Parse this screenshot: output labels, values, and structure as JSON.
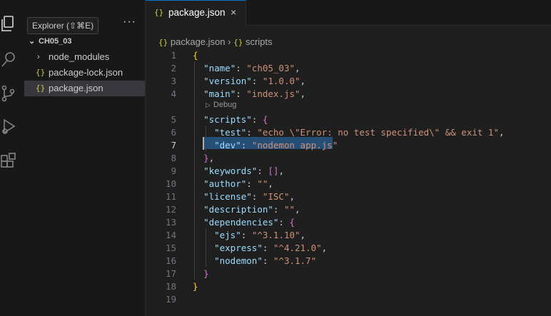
{
  "activity_bar": {
    "icons": [
      "explorer-icon",
      "search-icon",
      "source-control-icon",
      "run-debug-icon",
      "extensions-icon"
    ]
  },
  "sidebar": {
    "tooltip": "Explorer (⇧⌘E)",
    "more_label": "···",
    "folder_name": "CH05_03",
    "items": [
      {
        "label": "node_modules",
        "type": "folder"
      },
      {
        "label": "package-lock.json",
        "type": "json"
      },
      {
        "label": "package.json",
        "type": "json",
        "selected": true
      }
    ]
  },
  "editor": {
    "tab": {
      "label": "package.json",
      "icon": "{}",
      "close": "×"
    },
    "breadcrumb": {
      "file": "package.json",
      "separator": "›",
      "symbol": "scripts",
      "icon": "{}"
    },
    "codelens": {
      "label": "Debug",
      "icon": "▷"
    },
    "current_line": 7,
    "line_numbers": [
      "1",
      "2",
      "3",
      "4",
      "5",
      "6",
      "7",
      "8",
      "9",
      "10",
      "11",
      "12",
      "13",
      "14",
      "15",
      "16",
      "17",
      "18",
      "19"
    ],
    "lines": [
      {
        "tokens": [
          {
            "t": "{",
            "c": "b1"
          }
        ]
      },
      {
        "tokens": [
          {
            "t": "  ",
            "c": "p"
          },
          {
            "t": "\"name\"",
            "c": "k"
          },
          {
            "t": ": ",
            "c": "p"
          },
          {
            "t": "\"ch05_03\"",
            "c": "s"
          },
          {
            "t": ",",
            "c": "p"
          }
        ]
      },
      {
        "tokens": [
          {
            "t": "  ",
            "c": "p"
          },
          {
            "t": "\"version\"",
            "c": "k"
          },
          {
            "t": ": ",
            "c": "p"
          },
          {
            "t": "\"1.0.0\"",
            "c": "s"
          },
          {
            "t": ",",
            "c": "p"
          }
        ]
      },
      {
        "tokens": [
          {
            "t": "  ",
            "c": "p"
          },
          {
            "t": "\"main\"",
            "c": "k"
          },
          {
            "t": ": ",
            "c": "p"
          },
          {
            "t": "\"index.js\"",
            "c": "s"
          },
          {
            "t": ",",
            "c": "p"
          }
        ]
      },
      {
        "tokens": [
          {
            "t": "  ",
            "c": "p"
          },
          {
            "t": "\"scripts\"",
            "c": "k"
          },
          {
            "t": ": ",
            "c": "p"
          },
          {
            "t": "{",
            "c": "b2"
          }
        ]
      },
      {
        "tokens": [
          {
            "t": "    ",
            "c": "p"
          },
          {
            "t": "\"test\"",
            "c": "k"
          },
          {
            "t": ": ",
            "c": "p"
          },
          {
            "t": "\"echo \\\"Error: no test specified\\\" && exit 1\"",
            "c": "s"
          },
          {
            "t": ",",
            "c": "p"
          }
        ]
      },
      {
        "tokens": [
          {
            "t": "    ",
            "c": "p"
          },
          {
            "t": "\"dev\"",
            "c": "k"
          },
          {
            "t": ": ",
            "c": "p"
          },
          {
            "t": "\"nodemon app.js\"",
            "c": "s"
          }
        ]
      },
      {
        "tokens": [
          {
            "t": "  ",
            "c": "p"
          },
          {
            "t": "}",
            "c": "b2"
          },
          {
            "t": ",",
            "c": "p"
          }
        ]
      },
      {
        "tokens": [
          {
            "t": "  ",
            "c": "p"
          },
          {
            "t": "\"keywords\"",
            "c": "k"
          },
          {
            "t": ": ",
            "c": "p"
          },
          {
            "t": "[]",
            "c": "b2"
          },
          {
            "t": ",",
            "c": "p"
          }
        ]
      },
      {
        "tokens": [
          {
            "t": "  ",
            "c": "p"
          },
          {
            "t": "\"author\"",
            "c": "k"
          },
          {
            "t": ": ",
            "c": "p"
          },
          {
            "t": "\"\"",
            "c": "s"
          },
          {
            "t": ",",
            "c": "p"
          }
        ]
      },
      {
        "tokens": [
          {
            "t": "  ",
            "c": "p"
          },
          {
            "t": "\"license\"",
            "c": "k"
          },
          {
            "t": ": ",
            "c": "p"
          },
          {
            "t": "\"ISC\"",
            "c": "s"
          },
          {
            "t": ",",
            "c": "p"
          }
        ]
      },
      {
        "tokens": [
          {
            "t": "  ",
            "c": "p"
          },
          {
            "t": "\"description\"",
            "c": "k"
          },
          {
            "t": ": ",
            "c": "p"
          },
          {
            "t": "\"\"",
            "c": "s"
          },
          {
            "t": ",",
            "c": "p"
          }
        ]
      },
      {
        "tokens": [
          {
            "t": "  ",
            "c": "p"
          },
          {
            "t": "\"dependencies\"",
            "c": "k"
          },
          {
            "t": ": ",
            "c": "p"
          },
          {
            "t": "{",
            "c": "b2"
          }
        ]
      },
      {
        "tokens": [
          {
            "t": "    ",
            "c": "p"
          },
          {
            "t": "\"ejs\"",
            "c": "k"
          },
          {
            "t": ": ",
            "c": "p"
          },
          {
            "t": "\"^3.1.10\"",
            "c": "s"
          },
          {
            "t": ",",
            "c": "p"
          }
        ]
      },
      {
        "tokens": [
          {
            "t": "    ",
            "c": "p"
          },
          {
            "t": "\"express\"",
            "c": "k"
          },
          {
            "t": ": ",
            "c": "p"
          },
          {
            "t": "\"^4.21.0\"",
            "c": "s"
          },
          {
            "t": ",",
            "c": "p"
          }
        ]
      },
      {
        "tokens": [
          {
            "t": "    ",
            "c": "p"
          },
          {
            "t": "\"nodemon\"",
            "c": "k"
          },
          {
            "t": ": ",
            "c": "p"
          },
          {
            "t": "\"^3.1.7\"",
            "c": "s"
          }
        ]
      },
      {
        "tokens": [
          {
            "t": "  ",
            "c": "p"
          },
          {
            "t": "}",
            "c": "b2"
          }
        ]
      },
      {
        "tokens": [
          {
            "t": "}",
            "c": "b1"
          }
        ]
      },
      {
        "tokens": []
      }
    ]
  },
  "colors": {
    "accent": "#0078d4",
    "key": "#9cdcfe",
    "string": "#ce9178",
    "bracket_outer": "#ffd700",
    "bracket_inner": "#da70d6",
    "selection": "#264f78"
  }
}
